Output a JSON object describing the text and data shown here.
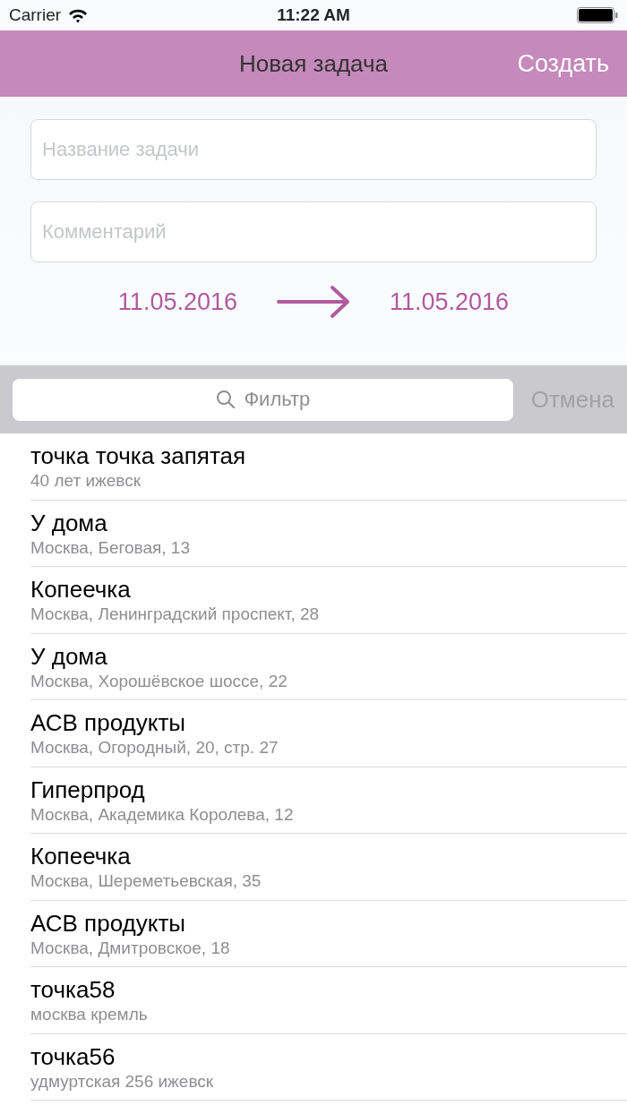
{
  "status_bar": {
    "carrier": "Carrier",
    "time": "11:22 AM"
  },
  "nav": {
    "title": "Новая задача",
    "action": "Создать"
  },
  "form": {
    "name_placeholder": "Название задачи",
    "comment_placeholder": "Комментарий",
    "start_date": "11.05.2016",
    "end_date": "11.05.2016"
  },
  "search": {
    "placeholder": "Фильтр",
    "cancel": "Отмена",
    "cancel_disabled": true
  },
  "points": [
    {
      "title": "точка точка запятая",
      "subtitle": "40 лет ижевск"
    },
    {
      "title": "У дома",
      "subtitle": "Москва, Беговая, 13"
    },
    {
      "title": "Копеечка",
      "subtitle": "Москва, Ленинградский проспект, 28"
    },
    {
      "title": "У дома",
      "subtitle": "Москва, Хорошёвское шоссе, 22"
    },
    {
      "title": "АСВ продукты",
      "subtitle": "Москва, Огородный, 20, стр. 27"
    },
    {
      "title": "Гиперпрод",
      "subtitle": "Москва, Академика Королева, 12"
    },
    {
      "title": "Копеечка",
      "subtitle": "Москва, Шереметьевская, 35"
    },
    {
      "title": "АСВ продукты",
      "subtitle": "Москва, Дмитровское, 18"
    },
    {
      "title": "точка58",
      "subtitle": "москва кремль"
    },
    {
      "title": "точка56",
      "subtitle": "удмуртская 256 ижевск"
    }
  ]
}
